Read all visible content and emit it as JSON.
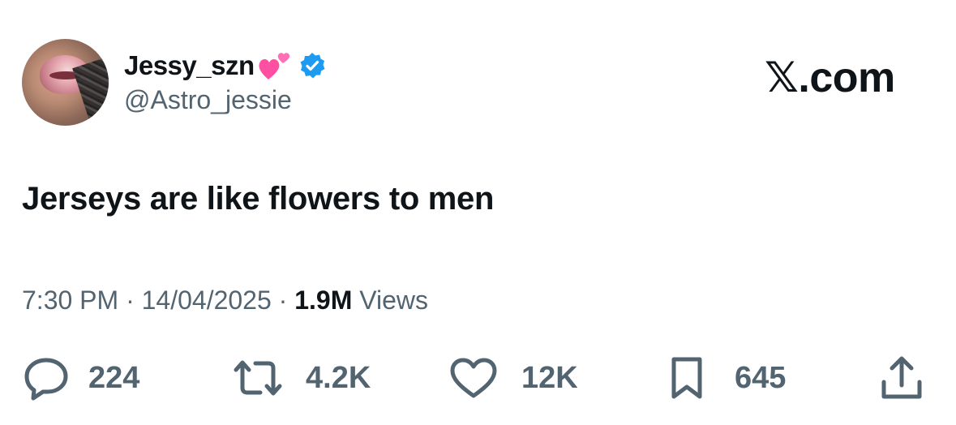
{
  "author": {
    "display_name": "Jessy_szn",
    "handle": "@Astro_jessie",
    "verified": true,
    "emoji_icon": "two-hearts-icon"
  },
  "brand": {
    "label": "𝕏.com"
  },
  "tweet": {
    "text": "Jerseys are like flowers to men"
  },
  "meta": {
    "time": "7:30 PM",
    "separator": "·",
    "date": "14/04/2025",
    "views_count": "1.9M",
    "views_label": "Views"
  },
  "actions": {
    "replies": "224",
    "reposts": "4.2K",
    "likes": "12K",
    "bookmarks": "645"
  },
  "colors": {
    "text": "#0f1419",
    "secondary": "#536471",
    "verified": "#1d9bf0",
    "heart_emoji": "#ff4fa3"
  }
}
